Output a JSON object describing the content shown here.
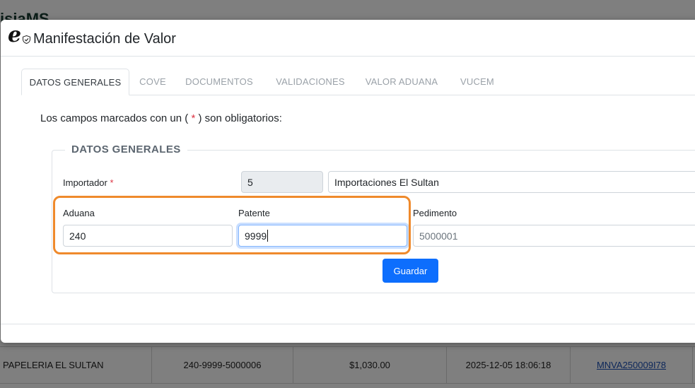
{
  "background": {
    "page_heading": "isiaMS",
    "table_row": {
      "client": "PAPELERIA EL SULTAN",
      "pedimento": "240-9999-5000006",
      "amount": "$1,030.00",
      "datetime": "2025-12-05 18:06:18",
      "folio_link": "MNVA250009I78"
    }
  },
  "modal": {
    "title": "Manifestación de Valor",
    "logo_icon": "e-shield-logo",
    "tabs": [
      {
        "label": "DATOS GENERALES",
        "active": true
      },
      {
        "label": "COVE",
        "active": false
      },
      {
        "label": "DOCUMENTOS",
        "active": false
      },
      {
        "label": "VALIDACIONES",
        "active": false
      },
      {
        "label": "VALOR ADUANA",
        "active": false
      },
      {
        "label": "VUCEM",
        "active": false
      }
    ],
    "required_note": {
      "before": "Los campos marcados con un (",
      "star": " * ",
      "after": ") son obligatorios:"
    },
    "section_legend": "DATOS GENERALES",
    "importador": {
      "label": "Importador",
      "required_star": "*",
      "code": "5",
      "name": "Importaciones El Sultan"
    },
    "aduana": {
      "label": "Aduana",
      "value": "240"
    },
    "patente": {
      "label": "Patente",
      "value": "9999"
    },
    "pedimento": {
      "label": "Pedimento",
      "placeholder": "5000001"
    },
    "save_button": "Guardar"
  },
  "colors": {
    "primary": "#0d6efd",
    "highlight": "#ef8a2c",
    "required": "#dc3545"
  }
}
